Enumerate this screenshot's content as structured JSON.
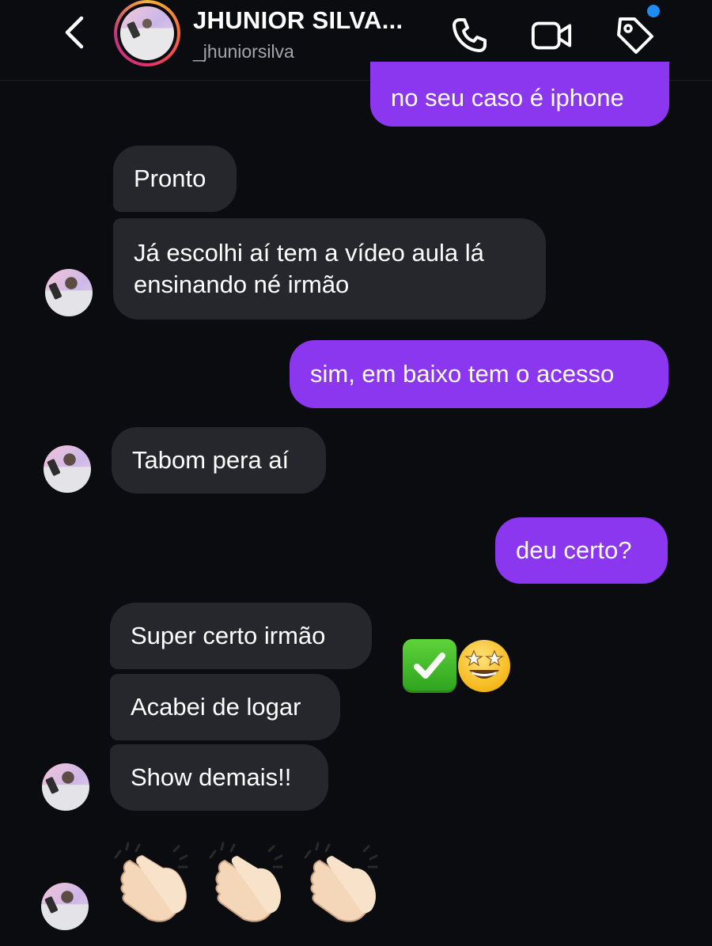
{
  "header": {
    "title": "JHUNIOR SILVA...",
    "username": "_jhuniorsilva"
  },
  "icons": {
    "back": "chevron-left-icon",
    "call": "phone-icon",
    "video": "video-camera-icon",
    "tag": "tag-icon"
  },
  "colors": {
    "background": "#0b0c10",
    "incoming_bubble": "#26272d",
    "outgoing_bubble": "#8b37ef",
    "notification_dot": "#1f8cf2"
  },
  "messages": [
    {
      "from": "me",
      "text": "no seu caso é iphone"
    },
    {
      "from": "them",
      "text": "Pronto"
    },
    {
      "from": "them",
      "text": "Já escolhi aí tem a vídeo aula lá ensinando né irmão"
    },
    {
      "from": "me",
      "text": "sim, em baixo tem o acesso"
    },
    {
      "from": "them",
      "text": "Tabom pera aí"
    },
    {
      "from": "me",
      "text": "deu certo?"
    },
    {
      "from": "them",
      "text": "Super certo irmão"
    },
    {
      "from": "them",
      "text": "Acabei de logar"
    },
    {
      "from": "them",
      "text": "Show demais!!"
    }
  ],
  "reactions": [
    "check-mark-button-emoji",
    "star-struck-emoji"
  ],
  "last_message_emoji": [
    "clapping-hands-emoji",
    "clapping-hands-emoji",
    "clapping-hands-emoji"
  ]
}
